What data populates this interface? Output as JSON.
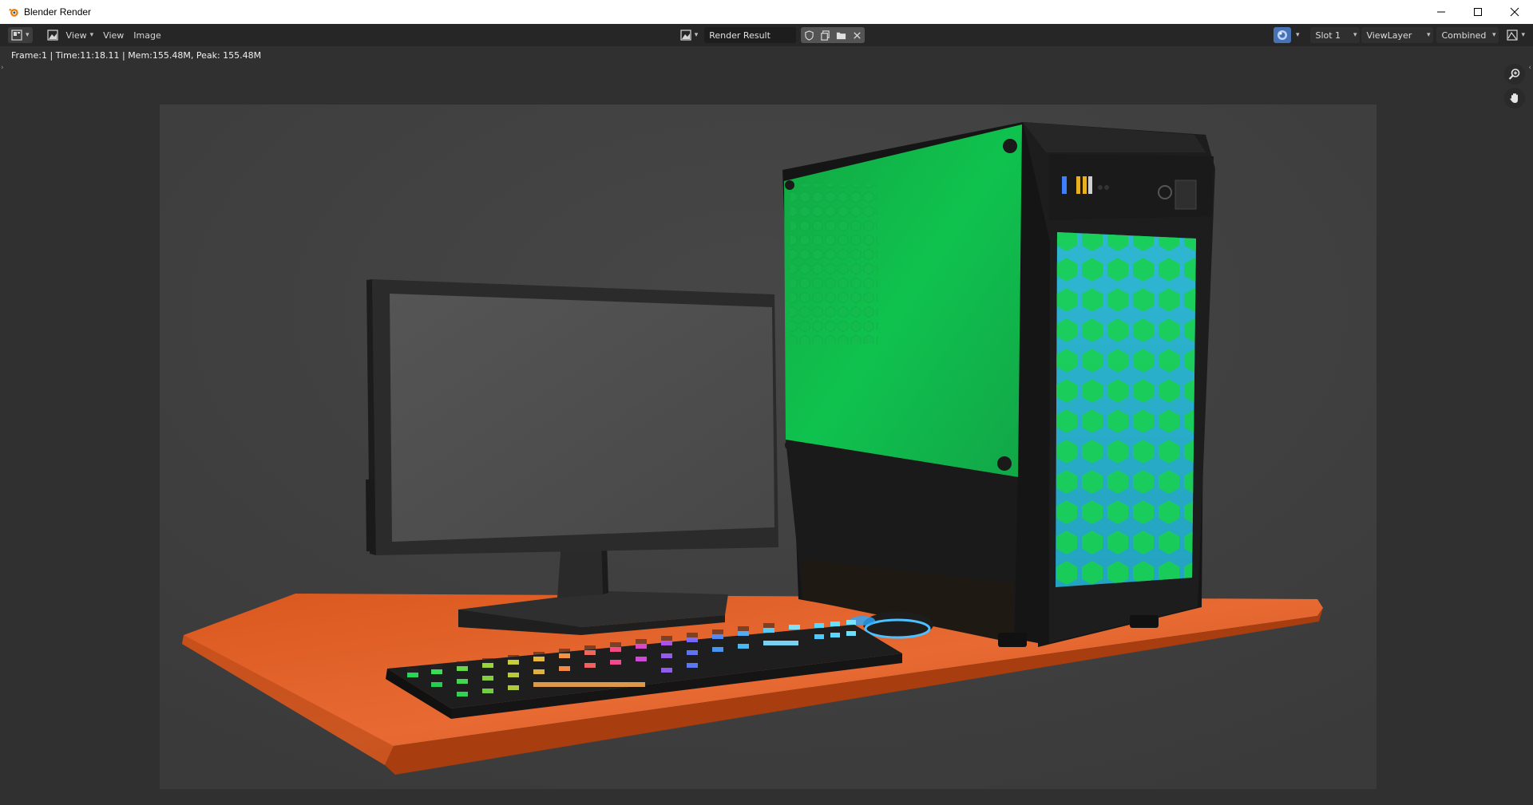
{
  "window": {
    "title": "Blender Render"
  },
  "header": {
    "menus": [
      "View",
      "View",
      "Image"
    ],
    "image_name": "Render Result",
    "slot": "Slot 1",
    "view_layer": "ViewLayer",
    "pass": "Combined"
  },
  "info": {
    "stats": "Frame:1 | Time:11:18.11 | Mem:155.48M, Peak: 155.48M"
  },
  "icons": {
    "editor_type": "image-editor-icon",
    "view_mode": "image-view-icon",
    "zoom": "zoom-icon",
    "pan": "hand-icon"
  },
  "colors": {
    "accent": "#4772b3",
    "titlebar_bg": "#ffffff",
    "header_bg": "#262626",
    "background": "#303030",
    "render_bg": "#3f3f3f",
    "green_panel": "#0fc24e",
    "desk_orange": "#e0612a",
    "cyan_front": "#2bb3c9"
  }
}
